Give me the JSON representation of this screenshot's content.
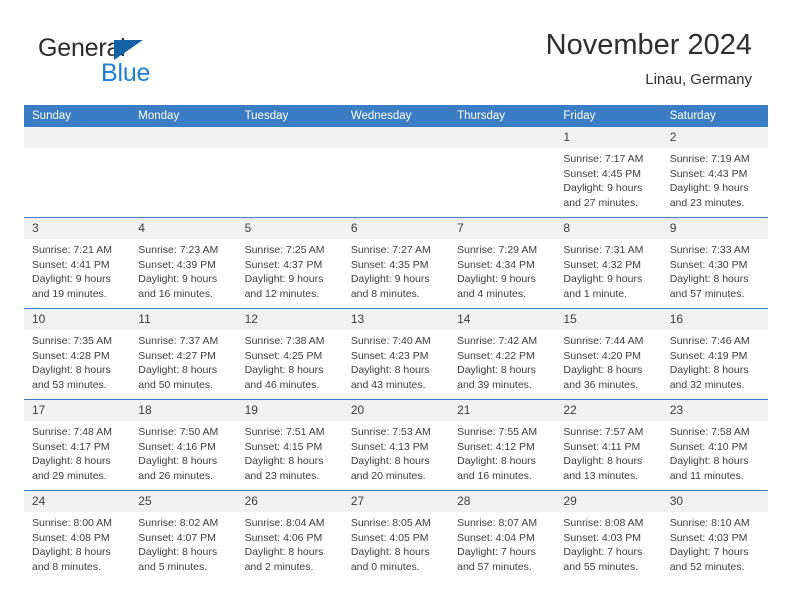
{
  "brand": {
    "name_part1": "General",
    "name_part2": "Blue",
    "accent_color": "#1b7fd4",
    "triangle_color": "#1462a6"
  },
  "header": {
    "title": "November 2024",
    "subtitle": "Linau, Germany"
  },
  "theme": {
    "header_row_bg": "#3b7dc4",
    "daynum_bg": "#f1f1f1",
    "text_color": "#3d3d3d"
  },
  "weekdays": [
    "Sunday",
    "Monday",
    "Tuesday",
    "Wednesday",
    "Thursday",
    "Friday",
    "Saturday"
  ],
  "weeks": [
    [
      {
        "day": "",
        "empty": true
      },
      {
        "day": "",
        "empty": true
      },
      {
        "day": "",
        "empty": true
      },
      {
        "day": "",
        "empty": true
      },
      {
        "day": "",
        "empty": true
      },
      {
        "day": "1",
        "sunrise": "Sunrise: 7:17 AM",
        "sunset": "Sunset: 4:45 PM",
        "daylight_line1": "Daylight: 9 hours",
        "daylight_line2": "and 27 minutes."
      },
      {
        "day": "2",
        "sunrise": "Sunrise: 7:19 AM",
        "sunset": "Sunset: 4:43 PM",
        "daylight_line1": "Daylight: 9 hours",
        "daylight_line2": "and 23 minutes."
      }
    ],
    [
      {
        "day": "3",
        "sunrise": "Sunrise: 7:21 AM",
        "sunset": "Sunset: 4:41 PM",
        "daylight_line1": "Daylight: 9 hours",
        "daylight_line2": "and 19 minutes."
      },
      {
        "day": "4",
        "sunrise": "Sunrise: 7:23 AM",
        "sunset": "Sunset: 4:39 PM",
        "daylight_line1": "Daylight: 9 hours",
        "daylight_line2": "and 16 minutes."
      },
      {
        "day": "5",
        "sunrise": "Sunrise: 7:25 AM",
        "sunset": "Sunset: 4:37 PM",
        "daylight_line1": "Daylight: 9 hours",
        "daylight_line2": "and 12 minutes."
      },
      {
        "day": "6",
        "sunrise": "Sunrise: 7:27 AM",
        "sunset": "Sunset: 4:35 PM",
        "daylight_line1": "Daylight: 9 hours",
        "daylight_line2": "and 8 minutes."
      },
      {
        "day": "7",
        "sunrise": "Sunrise: 7:29 AM",
        "sunset": "Sunset: 4:34 PM",
        "daylight_line1": "Daylight: 9 hours",
        "daylight_line2": "and 4 minutes."
      },
      {
        "day": "8",
        "sunrise": "Sunrise: 7:31 AM",
        "sunset": "Sunset: 4:32 PM",
        "daylight_line1": "Daylight: 9 hours",
        "daylight_line2": "and 1 minute."
      },
      {
        "day": "9",
        "sunrise": "Sunrise: 7:33 AM",
        "sunset": "Sunset: 4:30 PM",
        "daylight_line1": "Daylight: 8 hours",
        "daylight_line2": "and 57 minutes."
      }
    ],
    [
      {
        "day": "10",
        "sunrise": "Sunrise: 7:35 AM",
        "sunset": "Sunset: 4:28 PM",
        "daylight_line1": "Daylight: 8 hours",
        "daylight_line2": "and 53 minutes."
      },
      {
        "day": "11",
        "sunrise": "Sunrise: 7:37 AM",
        "sunset": "Sunset: 4:27 PM",
        "daylight_line1": "Daylight: 8 hours",
        "daylight_line2": "and 50 minutes."
      },
      {
        "day": "12",
        "sunrise": "Sunrise: 7:38 AM",
        "sunset": "Sunset: 4:25 PM",
        "daylight_line1": "Daylight: 8 hours",
        "daylight_line2": "and 46 minutes."
      },
      {
        "day": "13",
        "sunrise": "Sunrise: 7:40 AM",
        "sunset": "Sunset: 4:23 PM",
        "daylight_line1": "Daylight: 8 hours",
        "daylight_line2": "and 43 minutes."
      },
      {
        "day": "14",
        "sunrise": "Sunrise: 7:42 AM",
        "sunset": "Sunset: 4:22 PM",
        "daylight_line1": "Daylight: 8 hours",
        "daylight_line2": "and 39 minutes."
      },
      {
        "day": "15",
        "sunrise": "Sunrise: 7:44 AM",
        "sunset": "Sunset: 4:20 PM",
        "daylight_line1": "Daylight: 8 hours",
        "daylight_line2": "and 36 minutes."
      },
      {
        "day": "16",
        "sunrise": "Sunrise: 7:46 AM",
        "sunset": "Sunset: 4:19 PM",
        "daylight_line1": "Daylight: 8 hours",
        "daylight_line2": "and 32 minutes."
      }
    ],
    [
      {
        "day": "17",
        "sunrise": "Sunrise: 7:48 AM",
        "sunset": "Sunset: 4:17 PM",
        "daylight_line1": "Daylight: 8 hours",
        "daylight_line2": "and 29 minutes."
      },
      {
        "day": "18",
        "sunrise": "Sunrise: 7:50 AM",
        "sunset": "Sunset: 4:16 PM",
        "daylight_line1": "Daylight: 8 hours",
        "daylight_line2": "and 26 minutes."
      },
      {
        "day": "19",
        "sunrise": "Sunrise: 7:51 AM",
        "sunset": "Sunset: 4:15 PM",
        "daylight_line1": "Daylight: 8 hours",
        "daylight_line2": "and 23 minutes."
      },
      {
        "day": "20",
        "sunrise": "Sunrise: 7:53 AM",
        "sunset": "Sunset: 4:13 PM",
        "daylight_line1": "Daylight: 8 hours",
        "daylight_line2": "and 20 minutes."
      },
      {
        "day": "21",
        "sunrise": "Sunrise: 7:55 AM",
        "sunset": "Sunset: 4:12 PM",
        "daylight_line1": "Daylight: 8 hours",
        "daylight_line2": "and 16 minutes."
      },
      {
        "day": "22",
        "sunrise": "Sunrise: 7:57 AM",
        "sunset": "Sunset: 4:11 PM",
        "daylight_line1": "Daylight: 8 hours",
        "daylight_line2": "and 13 minutes."
      },
      {
        "day": "23",
        "sunrise": "Sunrise: 7:58 AM",
        "sunset": "Sunset: 4:10 PM",
        "daylight_line1": "Daylight: 8 hours",
        "daylight_line2": "and 11 minutes."
      }
    ],
    [
      {
        "day": "24",
        "sunrise": "Sunrise: 8:00 AM",
        "sunset": "Sunset: 4:08 PM",
        "daylight_line1": "Daylight: 8 hours",
        "daylight_line2": "and 8 minutes."
      },
      {
        "day": "25",
        "sunrise": "Sunrise: 8:02 AM",
        "sunset": "Sunset: 4:07 PM",
        "daylight_line1": "Daylight: 8 hours",
        "daylight_line2": "and 5 minutes."
      },
      {
        "day": "26",
        "sunrise": "Sunrise: 8:04 AM",
        "sunset": "Sunset: 4:06 PM",
        "daylight_line1": "Daylight: 8 hours",
        "daylight_line2": "and 2 minutes."
      },
      {
        "day": "27",
        "sunrise": "Sunrise: 8:05 AM",
        "sunset": "Sunset: 4:05 PM",
        "daylight_line1": "Daylight: 8 hours",
        "daylight_line2": "and 0 minutes."
      },
      {
        "day": "28",
        "sunrise": "Sunrise: 8:07 AM",
        "sunset": "Sunset: 4:04 PM",
        "daylight_line1": "Daylight: 7 hours",
        "daylight_line2": "and 57 minutes."
      },
      {
        "day": "29",
        "sunrise": "Sunrise: 8:08 AM",
        "sunset": "Sunset: 4:03 PM",
        "daylight_line1": "Daylight: 7 hours",
        "daylight_line2": "and 55 minutes."
      },
      {
        "day": "30",
        "sunrise": "Sunrise: 8:10 AM",
        "sunset": "Sunset: 4:03 PM",
        "daylight_line1": "Daylight: 7 hours",
        "daylight_line2": "and 52 minutes."
      }
    ]
  ]
}
